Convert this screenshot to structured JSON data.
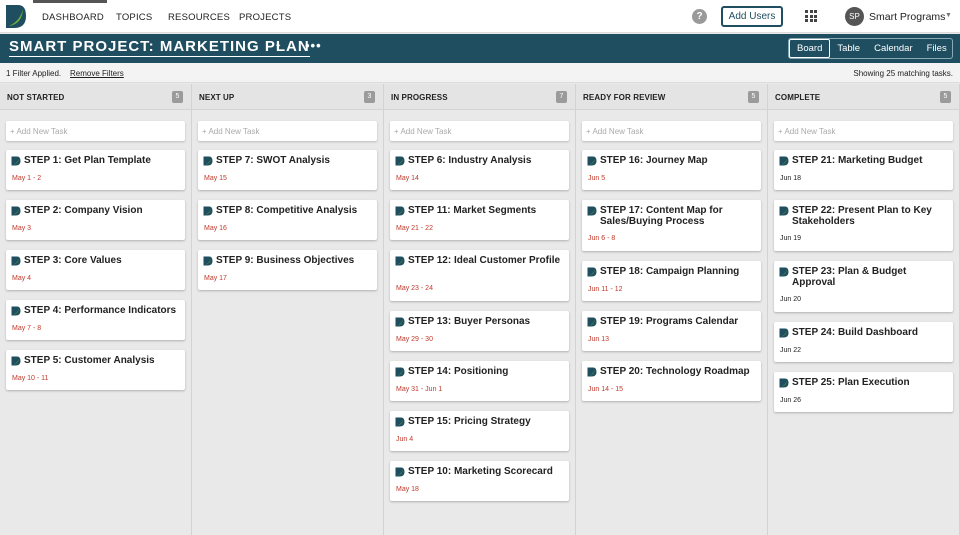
{
  "nav": {
    "items": [
      "DASHBOARD",
      "TOPICS",
      "RESOURCES",
      "PROJECTS"
    ],
    "help_label": "?",
    "add_users_label": "Add Users",
    "user": {
      "initials": "SP",
      "name": "Smart Programs"
    }
  },
  "project": {
    "title": "SMART PROJECT: MARKETING PLAN",
    "more_label": "•••",
    "views": [
      "Board",
      "Table",
      "Calendar",
      "Files"
    ],
    "active_view": "Board"
  },
  "filter": {
    "applied_text": "1 Filter Applied.",
    "remove_label": "Remove Filters",
    "matching_text": "Showing 25 matching tasks."
  },
  "colors": {
    "header_bg": "#1e4e60",
    "date_red": "#c0392b",
    "date_dark": "#222222",
    "icon_green": "#4a8c3a"
  },
  "add_task_placeholder": "+ Add New Task",
  "columns": [
    {
      "title": "NOT STARTED",
      "count": "5",
      "cards": [
        {
          "title": "STEP 1: Get Plan Template",
          "date": "May 1 - 2",
          "overdue": true
        },
        {
          "title": "STEP 2: Company Vision",
          "date": "May 3",
          "overdue": true
        },
        {
          "title": "STEP 3: Core Values",
          "date": "May 4",
          "overdue": true
        },
        {
          "title": "STEP 4: Performance Indicators",
          "date": "May 7 - 8",
          "overdue": true
        },
        {
          "title": "STEP 5: Customer Analysis",
          "date": "May 10 - 11",
          "overdue": true
        }
      ]
    },
    {
      "title": "NEXT UP",
      "count": "3",
      "cards": [
        {
          "title": "STEP 7: SWOT Analysis",
          "date": "May 15",
          "overdue": true
        },
        {
          "title": "STEP 8: Competitive Analysis",
          "date": "May 16",
          "overdue": true
        },
        {
          "title": "STEP 9: Business Objectives",
          "date": "May 17",
          "overdue": true
        }
      ]
    },
    {
      "title": "IN PROGRESS",
      "count": "7",
      "cards": [
        {
          "title": "STEP 6: Industry Analysis",
          "date": "May 14",
          "overdue": true
        },
        {
          "title": "STEP 11: Market Segments",
          "date": "May 21 - 22",
          "overdue": true
        },
        {
          "title": "STEP 12: Ideal Customer Profile",
          "date": "May 23 - 24",
          "overdue": true
        },
        {
          "title": "STEP 13: Buyer Personas",
          "date": "May 29 - 30",
          "overdue": true
        },
        {
          "title": "STEP 14: Positioning",
          "date": "May 31 - Jun 1",
          "overdue": true
        },
        {
          "title": "STEP 15: Pricing Strategy",
          "date": "Jun 4",
          "overdue": true
        },
        {
          "title": "STEP 10: Marketing Scorecard",
          "date": "May 18",
          "overdue": true
        }
      ]
    },
    {
      "title": "READY FOR REVIEW",
      "count": "5",
      "cards": [
        {
          "title": "STEP 16: Journey Map",
          "date": "Jun 5",
          "overdue": true
        },
        {
          "title": "STEP 17: Content Map for Sales/Buying Process",
          "date": "Jun 6 - 8",
          "overdue": true
        },
        {
          "title": "STEP 18: Campaign Planning",
          "date": "Jun 11 - 12",
          "overdue": true
        },
        {
          "title": "STEP 19: Programs Calendar",
          "date": "Jun 13",
          "overdue": true
        },
        {
          "title": "STEP 20: Technology Roadmap",
          "date": "Jun 14 - 15",
          "overdue": true
        }
      ]
    },
    {
      "title": "COMPLETE",
      "count": "5",
      "cards": [
        {
          "title": "STEP 21: Marketing Budget",
          "date": "Jun 18",
          "overdue": false
        },
        {
          "title": "STEP 22: Present Plan to Key Stakeholders",
          "date": "Jun 19",
          "overdue": false
        },
        {
          "title": "STEP 23: Plan & Budget Approval",
          "date": "Jun 20",
          "overdue": false
        },
        {
          "title": "STEP 24: Build Dashboard",
          "date": "Jun 22",
          "overdue": false
        },
        {
          "title": "STEP 25: Plan Execution",
          "date": "Jun 26",
          "overdue": false
        }
      ]
    }
  ]
}
